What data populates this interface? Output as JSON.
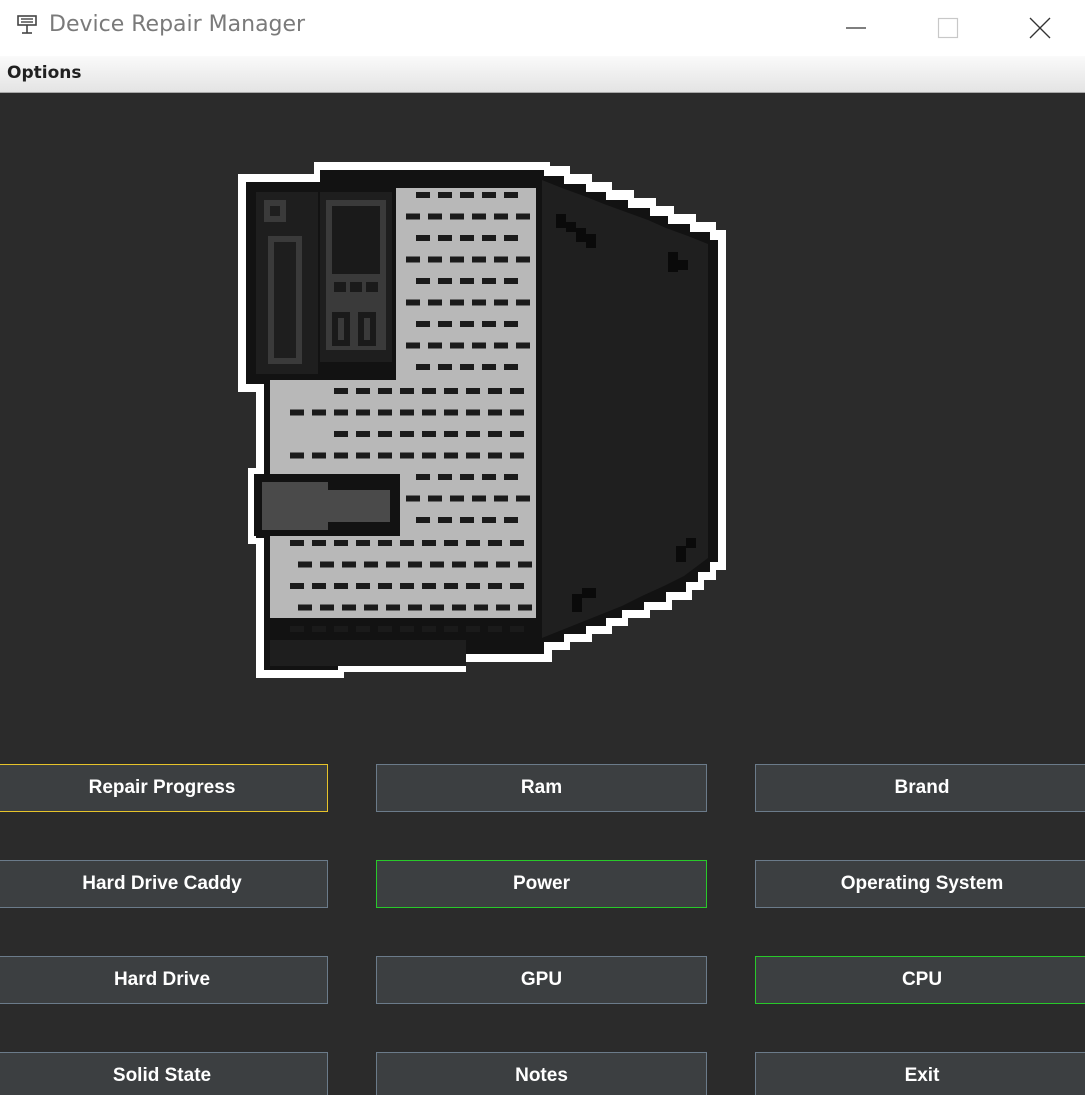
{
  "window": {
    "title": "Device Repair Manager"
  },
  "menubar": {
    "items": [
      {
        "label": "Options"
      }
    ]
  },
  "buttons": [
    {
      "label": "Repair Progress",
      "highlight": "yellow"
    },
    {
      "label": "Ram",
      "highlight": "none"
    },
    {
      "label": "Brand",
      "highlight": "none"
    },
    {
      "label": "Hard Drive Caddy",
      "highlight": "none"
    },
    {
      "label": "Power",
      "highlight": "green"
    },
    {
      "label": "Operating System",
      "highlight": "none"
    },
    {
      "label": "Hard Drive",
      "highlight": "none"
    },
    {
      "label": "GPU",
      "highlight": "none"
    },
    {
      "label": "CPU",
      "highlight": "green"
    },
    {
      "label": "Solid State",
      "highlight": "none"
    },
    {
      "label": "Notes",
      "highlight": "none"
    },
    {
      "label": "Exit",
      "highlight": "none"
    }
  ],
  "colors": {
    "background": "#2b2b2b",
    "button_bg": "#3c3f41",
    "button_border": "#6b7b8a",
    "focus_yellow": "#e6c32a",
    "highlight_green": "#28c92a"
  }
}
